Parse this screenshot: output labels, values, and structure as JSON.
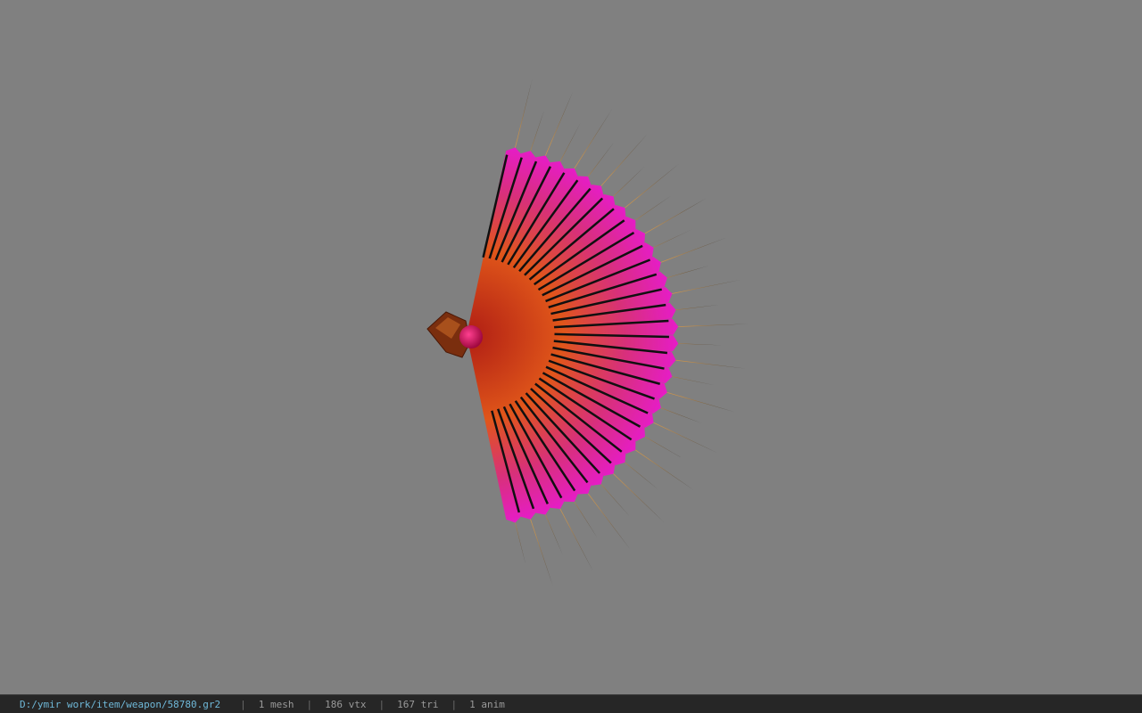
{
  "viewport": {
    "background_color": "#808080",
    "model": {
      "name": "weapon-fan-model",
      "colors": {
        "shaft_dark": "#c0281a",
        "shaft_light": "#e8621a",
        "feather_tip": "#e018c8",
        "feather_mid": "#d8357a",
        "spine": "#101010",
        "spike": "#e0a860",
        "spike_tip": "#1a1a1a",
        "hub": "#8a3410",
        "gem": "#d81060"
      }
    }
  },
  "statusbar": {
    "path": "D:/ymir work/item/weapon/58780.gr2",
    "separator": "|",
    "mesh": "1 mesh",
    "vtx": "186 vtx",
    "tri": "167 tri",
    "anim": "1 anim"
  }
}
